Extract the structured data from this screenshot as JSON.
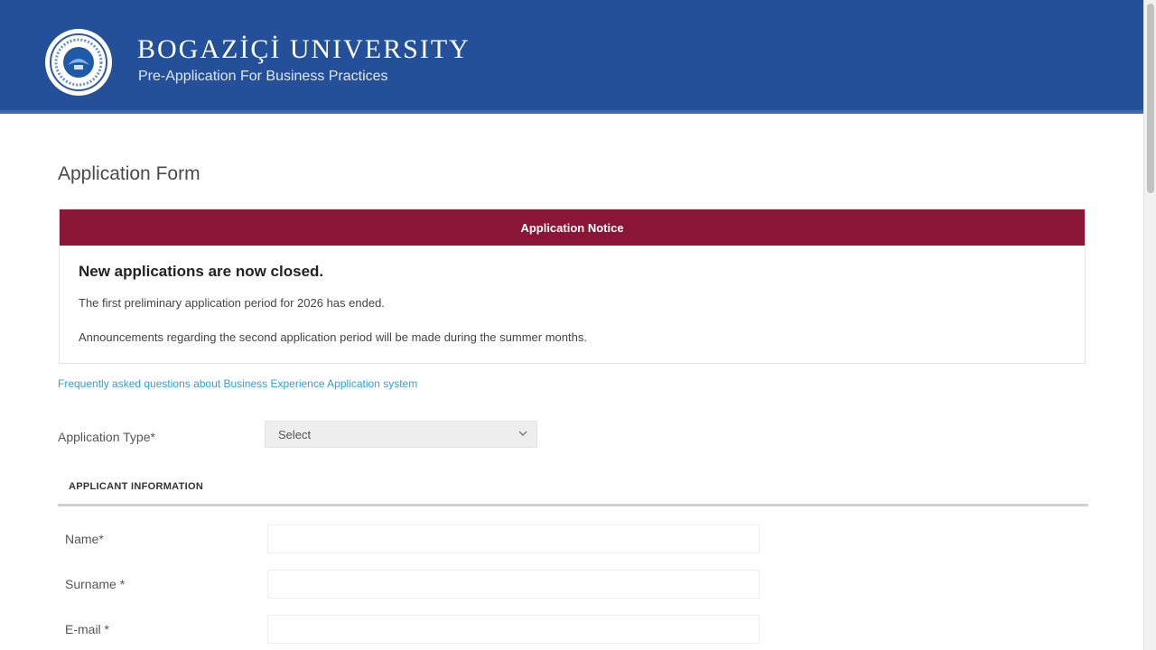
{
  "header": {
    "university_name": "BOGAZİÇİ UNIVERSITY",
    "subtitle": "Pre-Application For Business Practices",
    "background_color": "#24509a",
    "logo_icon": "university-seal-icon"
  },
  "page": {
    "title": "Application Form"
  },
  "notice": {
    "heading": "Application Notice",
    "heading_color": "#8b1536",
    "title": "New applications are now closed.",
    "line1": "The first preliminary application period for 2026 has ended.",
    "line2": "Announcements regarding the second application period will be made during the summer months."
  },
  "info_link": {
    "text": "Frequently asked questions about Business Experience Application system"
  },
  "application_type": {
    "label": "Application Type*",
    "selected": "Select",
    "chevron_icon": "chevron-down-icon"
  },
  "applicant_section": {
    "title": "APPLICANT INFORMATION",
    "fields": [
      {
        "label": "Name*",
        "value": ""
      },
      {
        "label": "Surname *",
        "value": ""
      },
      {
        "label": "E-mail *",
        "value": ""
      }
    ]
  }
}
